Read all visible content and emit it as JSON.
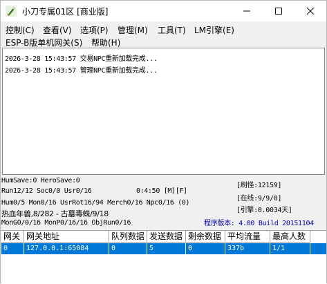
{
  "window": {
    "title": "小刀专属01区 [商业版]",
    "controls": {
      "minimize": "—",
      "maximize": "☐",
      "close": "✕"
    },
    "icon": "app-dagger-icon"
  },
  "menu": {
    "row1": [
      "控制(C)",
      "查看(V)",
      "选项(P)",
      "管理(M)",
      "工具(T)",
      "LM引擎(E)"
    ],
    "row2": [
      "ESP-B版单机网关(S)",
      "帮助(H)"
    ]
  },
  "log": {
    "lines": [
      "2026-3-28 15:43:57 交易NPC重新加载完成...",
      "2026-3-28 15:43:57 管理NPC重新加载完成..."
    ]
  },
  "status": {
    "line1": "HumSave:0 HeroSave:0",
    "line2": "Run12/12 Soc0/0 Usr0/16",
    "timer": "0:4:50 [M][F]",
    "line3": "Hum0/5 Mon0/16 UsrRot16/94 Merch0/16 Npc0/16 (0)",
    "line4": "热血年兽,8/282 - 古墓毒蛛/9/18",
    "line5": "MonG0/0/16 MonP0/16/16 ObjRun0/16",
    "brush": "[刷怪:12159]",
    "online": "[在线:9/9/0]",
    "engine": "[引擎:0.0034天]",
    "version": "程序版本: 4.00 Build 20151104"
  },
  "gateway_table": {
    "columns": [
      "网关",
      "网关地址",
      "队列数据",
      "发送数据",
      "剩余数据",
      "平均流量",
      "最高人数"
    ],
    "rows": [
      [
        "0",
        "127.0.0.1:65084",
        "0",
        "5",
        "0",
        "337b",
        "1/1"
      ]
    ]
  },
  "colors": {
    "selection": "#0078d7",
    "version_text": "#0000c0"
  }
}
